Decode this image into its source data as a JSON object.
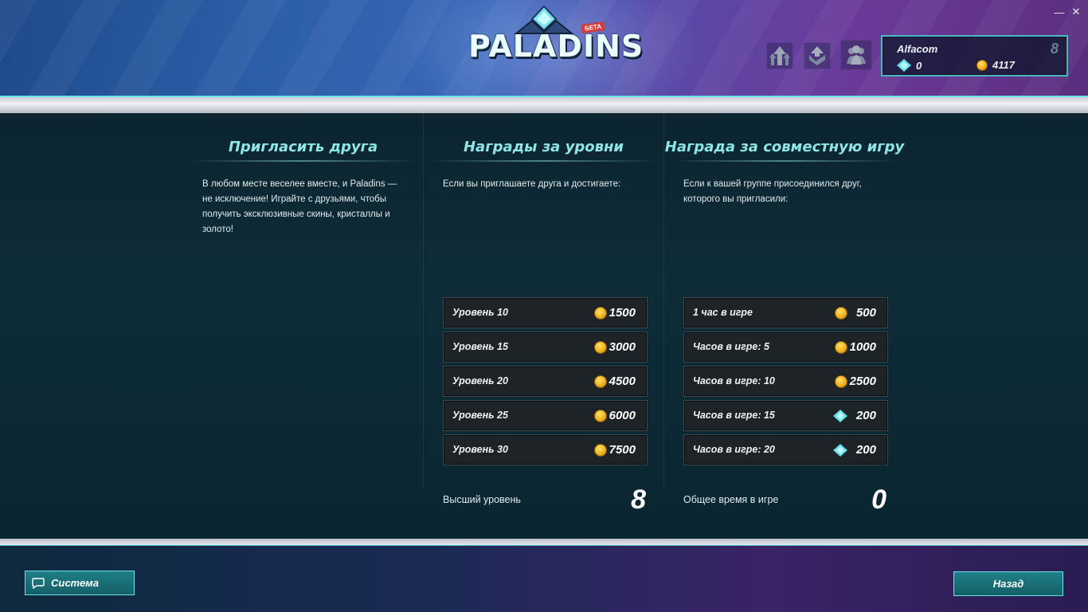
{
  "header": {
    "logo_text": "PALADINS",
    "logo_badge": "БЕТА",
    "profile": {
      "name": "Alfacom",
      "level": "8",
      "crystals": "0",
      "gold": "4117"
    },
    "icons": [
      "rank-up-icon",
      "rank-badge-icon",
      "party-icon"
    ]
  },
  "window": {
    "minimize": "—",
    "close": "✕"
  },
  "invite": {
    "title": "Пригласить друга",
    "desc": "В любом месте веселее вместе, и Paladins — не исключение! Играйте с друзьями, чтобы получить эксклюзивные скины, кристаллы и золото!"
  },
  "levels": {
    "title": "Награды за уровни",
    "desc": "Если вы приглашаете друга и достигаете:",
    "rows": [
      {
        "label": "Уровень 10",
        "amount": "1500",
        "currency": "gold"
      },
      {
        "label": "Уровень 15",
        "amount": "3000",
        "currency": "gold"
      },
      {
        "label": "Уровень 20",
        "amount": "4500",
        "currency": "gold"
      },
      {
        "label": "Уровень 25",
        "amount": "6000",
        "currency": "gold"
      },
      {
        "label": "Уровень 30",
        "amount": "7500",
        "currency": "gold"
      }
    ],
    "stat_label": "Высший уровень",
    "stat_value": "8"
  },
  "coop": {
    "title": "Награда за совместную игру",
    "desc": "Если к вашей группе присоединился друг, которого вы пригласили:",
    "rows": [
      {
        "label": "1 час в игре",
        "amount": "500",
        "currency": "gold"
      },
      {
        "label": "Часов в игре: 5",
        "amount": "1000",
        "currency": "gold"
      },
      {
        "label": "Часов в игре: 10",
        "amount": "2500",
        "currency": "gold"
      },
      {
        "label": "Часов в игре: 15",
        "amount": "200",
        "currency": "crystal"
      },
      {
        "label": "Часов в игре: 20",
        "amount": "200",
        "currency": "crystal"
      }
    ],
    "stat_label": "Общее время в игре",
    "stat_value": "0"
  },
  "footer": {
    "system_label": "Система",
    "back_label": "Назад"
  },
  "colors": {
    "accent": "#6de0ea",
    "title": "#8fe6e6",
    "gold": "#f0b21e",
    "crystal": "#5fe0e6"
  }
}
